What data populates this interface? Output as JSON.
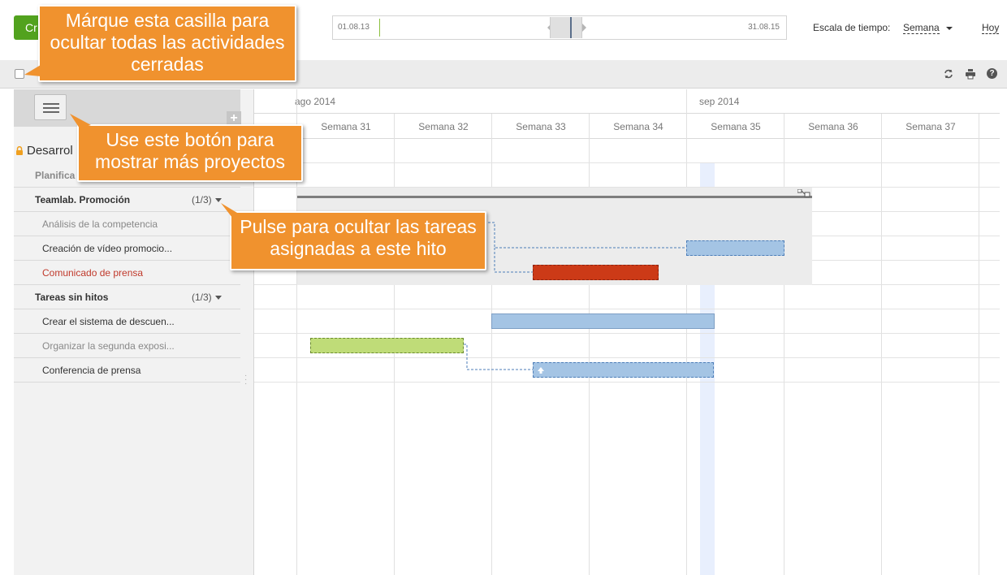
{
  "toolbar": {
    "create_label": "Cr",
    "timeline_start": "01.08.13",
    "timeline_end": "31.08.15",
    "scale_label": "Escala de tiempo:",
    "scale_value": "Semana",
    "today_label": "Hoy"
  },
  "project": {
    "name": "Desarrol",
    "rows": [
      {
        "name": "Planifica",
        "count": "",
        "type": "plan"
      },
      {
        "name": "Teamlab. Promoción",
        "count": "(1/3)",
        "type": "milestone"
      },
      {
        "name": "Análisis de la competencia",
        "count": "",
        "type": "closed"
      },
      {
        "name": "Creación de vídeo promocio...",
        "count": "",
        "type": "open"
      },
      {
        "name": "Comunicado de prensa",
        "count": "",
        "type": "overdue"
      },
      {
        "name": "Tareas sin hitos",
        "count": "(1/3)",
        "type": "milestone"
      },
      {
        "name": "Crear el sistema de descuen...",
        "count": "",
        "type": "open"
      },
      {
        "name": "Organizar la segunda exposi...",
        "count": "",
        "type": "closed"
      },
      {
        "name": "Conferencia de prensa",
        "count": "",
        "type": "open"
      }
    ]
  },
  "timeline": {
    "months": [
      "ago 2014",
      "sep 2014"
    ],
    "weeks": [
      "Semana 31",
      "Semana 32",
      "Semana 33",
      "Semana 34",
      "Semana 35",
      "Semana 36",
      "Semana 37"
    ]
  },
  "callouts": {
    "hide_closed": "Márque esta casilla para ocultar todas las actividades cerradas",
    "more_projects": "Use este botón para mostrar más proyectos",
    "hide_tasks": "Pulse para ocultar las tareas asignadas a este hito"
  },
  "colors": {
    "create_button": "#52a21e",
    "callout": "#f0922e",
    "bar_blue": "#a4c4e4",
    "bar_red": "#cc3a17",
    "bar_green": "#bfdc78",
    "today_column": "#e8effd"
  }
}
